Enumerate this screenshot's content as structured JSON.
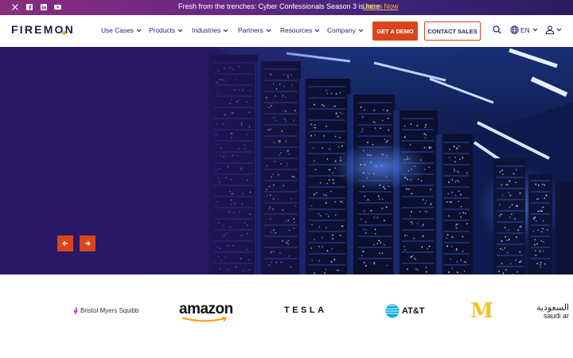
{
  "announcement": {
    "text": "Fresh from the trenches: Cyber Confessionals Season 3 is here.",
    "link_label": "Listen Now",
    "social_icons": [
      "x-icon",
      "facebook-icon",
      "linkedin-icon",
      "youtube-icon"
    ]
  },
  "header": {
    "logo_text": "FIREMON",
    "nav": [
      {
        "label": "Use Cases"
      },
      {
        "label": "Products"
      },
      {
        "label": "Industries"
      },
      {
        "label": "Partners"
      },
      {
        "label": "Resources"
      },
      {
        "label": "Company"
      }
    ],
    "demo_button": "GET A DEMO",
    "sales_button": "CONTACT SALES",
    "language": "EN"
  },
  "hero": {
    "prev_icon": "arrow-left-icon",
    "next_icon": "arrow-right-icon"
  },
  "customers": {
    "bms": "Bristol Myers Squibb",
    "amazon": "amazon",
    "tesla": "TESLA",
    "att": "AT&T",
    "mcdonalds": "M",
    "saudi_arabic": "السعودية",
    "saudi_english": "saudi ar"
  },
  "colors": {
    "accent": "#d8451c",
    "navy": "#2a2568",
    "link": "#f5b642",
    "hero_bg": "#2a1766"
  }
}
